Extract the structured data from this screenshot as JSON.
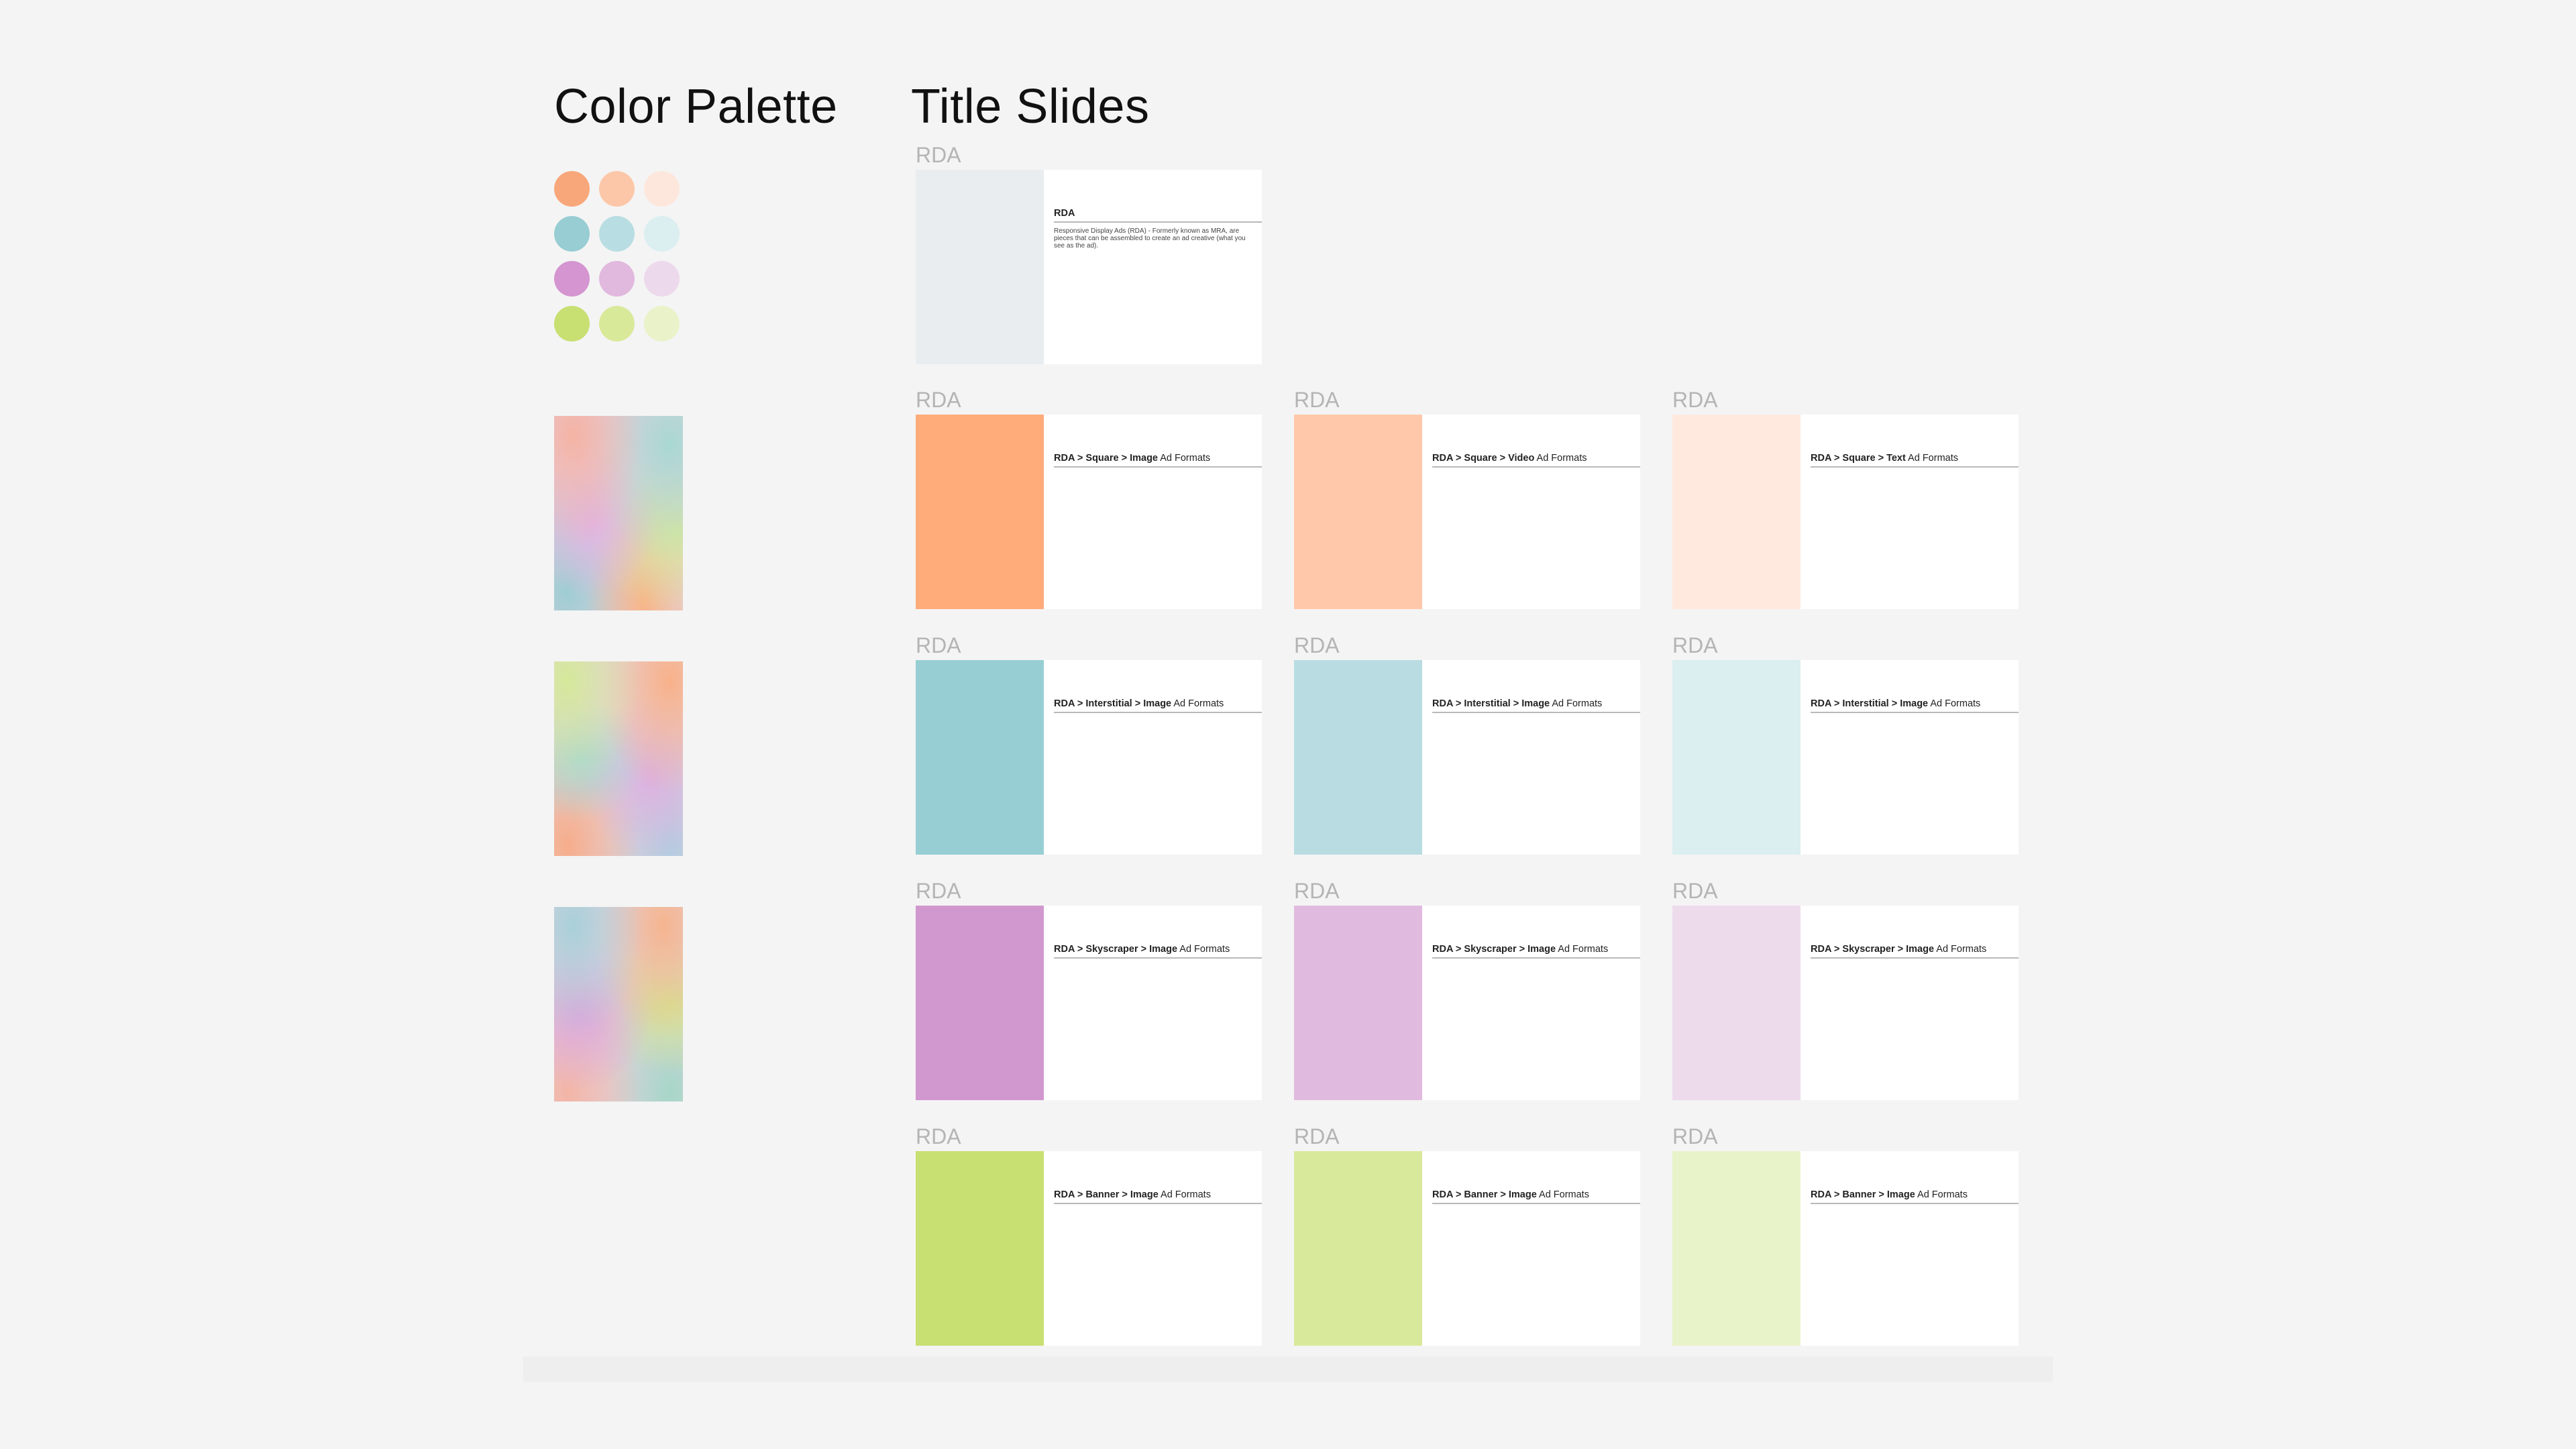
{
  "palette": {
    "title": "Color Palette",
    "swatches": [
      [
        "#f8a77a",
        "#fcc7a8",
        "#fde7dc"
      ],
      [
        "#97cdd3",
        "#b8dde2",
        "#dbeef0"
      ],
      [
        "#d495d0",
        "#e1b8de",
        "#edd9ec"
      ],
      [
        "#c8df72",
        "#d9e99a",
        "#e9f2c9"
      ]
    ]
  },
  "slides": {
    "title": "Title Slides",
    "tag": "RDA",
    "intro": {
      "heading": "RDA",
      "description": "Responsive Display Ads (RDA) - Formerly known as MRA, are pieces that can be assembled to create an ad creative (what you see as the ad).",
      "color": "#e9edef"
    },
    "rows": [
      {
        "bold": "RDA > Square > Image",
        "normal_suffix": " Ad Formats",
        "cards": [
          {
            "bold": "RDA > Square > Image",
            "rest": " Ad Formats",
            "color": "#ffab7a"
          },
          {
            "bold": "RDA > Square > Video",
            "rest": " Ad Formats",
            "color": "#ffc8aa"
          },
          {
            "bold": "RDA > Square > Text",
            "rest": " Ad Formats",
            "color": "#ffe9de"
          }
        ]
      },
      {
        "cards": [
          {
            "bold": "RDA > Interstitial > Image",
            "rest": " Ad Formats",
            "color": "#97ced3"
          },
          {
            "bold": "RDA > Interstitial > Image",
            "rest": " Ad Formats",
            "color": "#b8dce1"
          },
          {
            "bold": "RDA > Interstitial > Image",
            "rest": " Ad Formats",
            "color": "#dbeef0"
          }
        ]
      },
      {
        "cards": [
          {
            "bold": "RDA > Skyscraper > Image",
            "rest": " Ad Formats",
            "color": "#d197cf"
          },
          {
            "bold": "RDA > Skyscraper > Image",
            "rest": " Ad Formats",
            "color": "#e1badf"
          },
          {
            "bold": "RDA > Skyscraper > Image",
            "rest": " Ad Formats",
            "color": "#eddbec"
          }
        ]
      },
      {
        "cards": [
          {
            "bold": "RDA > Banner > Image",
            "rest": " Ad Formats",
            "color": "#c8df72"
          },
          {
            "bold": "RDA > Banner > Image",
            "rest": " Ad Formats",
            "color": "#d9e99b"
          },
          {
            "bold": "RDA > Banner > Image",
            "rest": " Ad Formats",
            "color": "#e9f3c9"
          }
        ]
      }
    ]
  }
}
